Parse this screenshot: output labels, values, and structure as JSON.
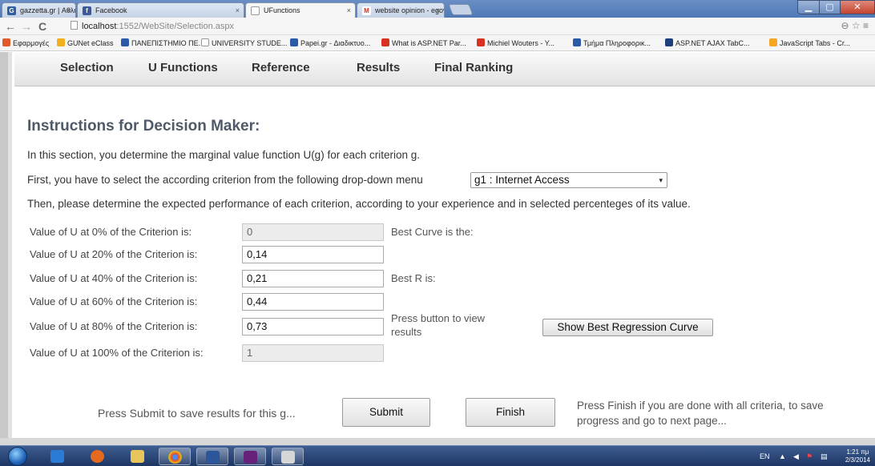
{
  "browser": {
    "tabs": [
      {
        "label": "gazzetta.gr | Αθλητικά Νέ",
        "icon": "gazzetta-favicon",
        "color": "#2f5f9e"
      },
      {
        "label": "Facebook",
        "icon": "facebook-favicon",
        "color": "#3b5998"
      },
      {
        "label": "UFunctions",
        "icon": "page-icon",
        "color": "#ffffff"
      },
      {
        "label": "website opinion - egovalu",
        "icon": "gmail-favicon",
        "color": "#d93025"
      }
    ],
    "close_glyph": "×",
    "url_host": "localhost",
    "url_rest": ":1552/WebSite/Selection.aspx",
    "bookmarks": [
      {
        "label": "Εφαρμογές",
        "color": "#e25a2a"
      },
      {
        "label": "GUNet eClass",
        "color": "#f2b01e"
      },
      {
        "label": "ΠΑΝΕΠΙΣΤΗΜΙΟ ΠΕ...",
        "color": "#2b5aa6"
      },
      {
        "label": "UNIVERSITY STUDE...",
        "color": "#ffffff"
      },
      {
        "label": "Papei.gr - Διαδικτυο...",
        "color": "#2b5aa6"
      },
      {
        "label": "What is ASP.NET Par...",
        "color": "#d9301f"
      },
      {
        "label": "Michiel Wouters - Y...",
        "color": "#d9301f"
      },
      {
        "label": "Τμήμα Πληροφορικ...",
        "color": "#2b5aa6"
      },
      {
        "label": "ASP.NET AJAX TabC...",
        "color": "#1f3f7a"
      },
      {
        "label": "JavaScript Tabs - Cr...",
        "color": "#f5a623"
      }
    ]
  },
  "menu": {
    "items": [
      "Selection",
      "U Functions",
      "Reference",
      "Results",
      "Final Ranking"
    ]
  },
  "instructions": {
    "heading": "Instructions for Decision Maker:",
    "line1": "In this section, you determine the marginal value function U(g) for each criterion g.",
    "line2": "First, you have to select the according criterion from the following drop-down menu",
    "line3": "Then, please determine the expected performance of each criterion, according to your experience and in selected percenteges of its value."
  },
  "criterion_select": {
    "selected": "g1 : Internet Access",
    "arrow": "▾"
  },
  "rows": [
    {
      "label": "Value of U at 0% of the Criterion is:",
      "value": "0"
    },
    {
      "label": "Value of U at 20% of the Criterion is:",
      "value": "0,14"
    },
    {
      "label": "Value of U at 40% of the Criterion is:",
      "value": "0,21"
    },
    {
      "label": "Value of U at 60% of the Criterion is:",
      "value": "0,44"
    },
    {
      "label": "Value of U at 80% of the Criterion is:",
      "value": "0,73"
    },
    {
      "label": "Value of U at 100% of the Criterion is:",
      "value": "1"
    }
  ],
  "results_info": {
    "best_curve": "Best Curve is the:",
    "best_r": "Best R is:",
    "press_button": "Press button to view results",
    "show_button": "Show Best Regression Curve"
  },
  "actions": {
    "press_submit": "Press Submit to save results for this g...",
    "submit": "Submit",
    "finish": "Finish",
    "press_finish": "Press Finish if you are done with all criteria, to save progress and go to next page..."
  },
  "taskbar": {
    "lang": "EN",
    "time": "1:21 πμ",
    "date": "2/3/2014"
  }
}
